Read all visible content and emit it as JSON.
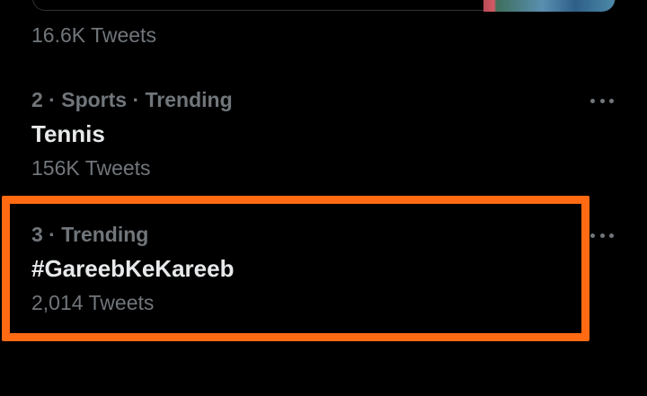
{
  "previous": {
    "count": "16.6K Tweets"
  },
  "trends": [
    {
      "meta": "2 · Sports · Trending",
      "name": "Tennis",
      "count": "156K Tweets"
    },
    {
      "meta": "3 · Trending",
      "name": "#GareebKeKareeb",
      "count": "2,014 Tweets"
    }
  ],
  "icons": {
    "more": "more-horizontal-icon"
  },
  "colors": {
    "highlight": "#ff6a13",
    "background": "#000000",
    "secondary_text": "#71767b",
    "primary_text": "#e7e9ea"
  }
}
